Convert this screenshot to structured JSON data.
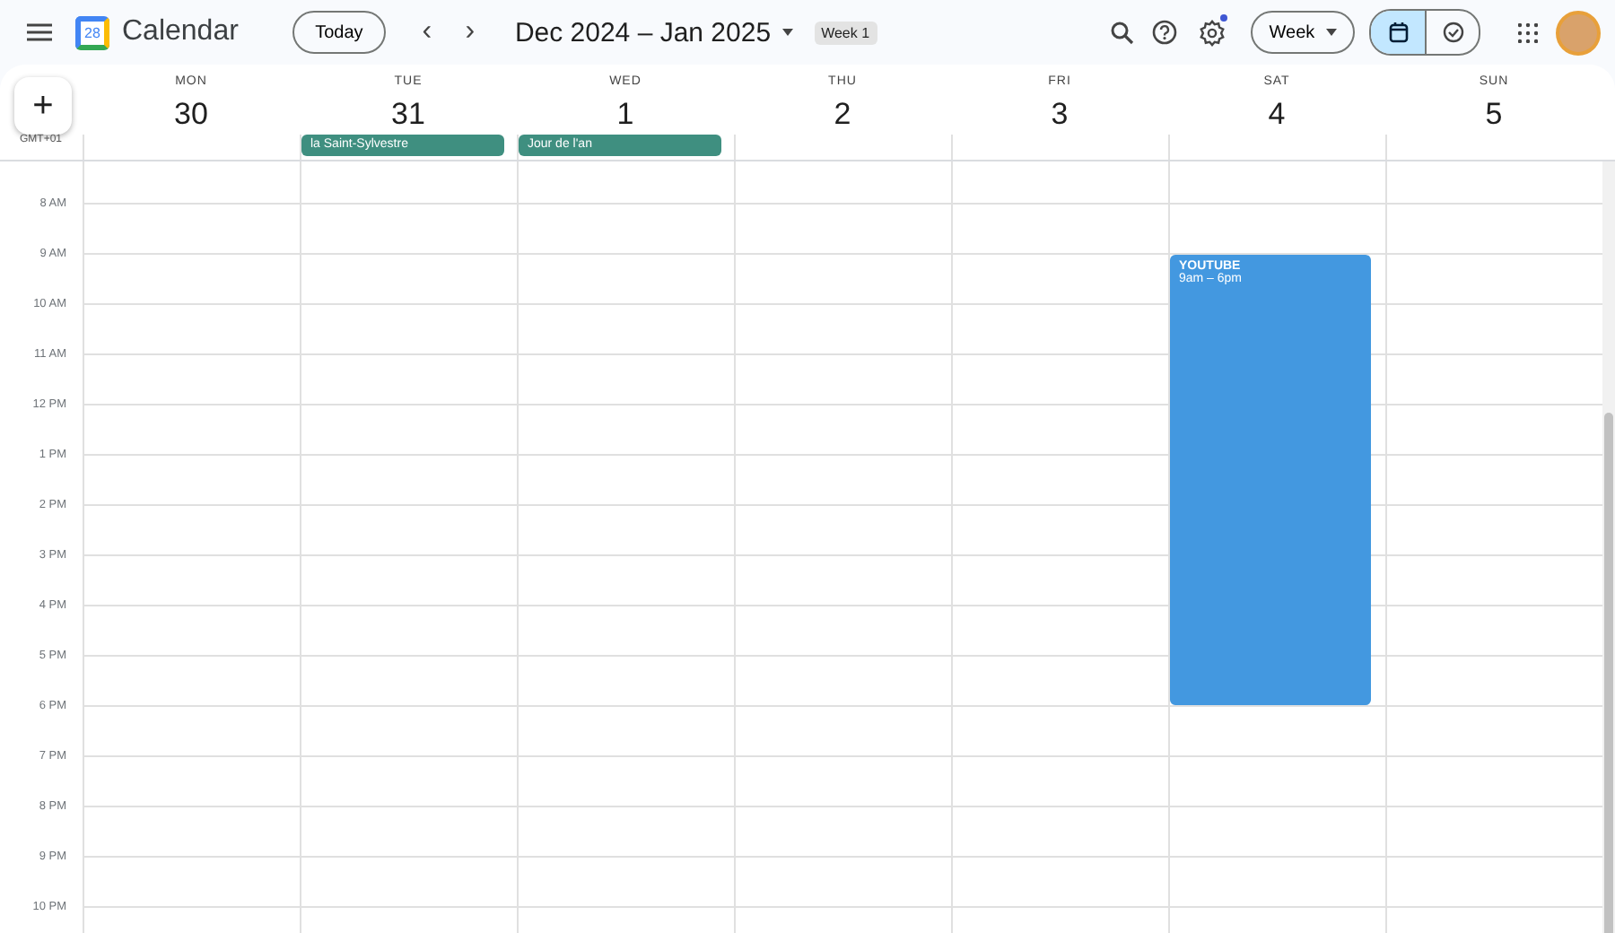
{
  "app": {
    "title": "Calendar",
    "logo_day": "28"
  },
  "toolbar": {
    "today": "Today",
    "prev": "‹",
    "next": "›",
    "range": "Dec 2024 – Jan 2025",
    "week_badge": "Week 1",
    "view": "Week",
    "settings_notification": true,
    "mode_toggle": [
      {
        "kind": "calendar",
        "selected": true
      },
      {
        "kind": "tasks",
        "selected": false
      }
    ]
  },
  "create": "+",
  "timezone": "GMT+01",
  "days": [
    {
      "weekday": "MON",
      "date": "30"
    },
    {
      "weekday": "TUE",
      "date": "31",
      "all_day": [
        {
          "title": "la Saint-Sylvestre",
          "color": "#3f8f80"
        }
      ]
    },
    {
      "weekday": "WED",
      "date": "1",
      "all_day": [
        {
          "title": "Jour de l'an",
          "color": "#3f8f80"
        }
      ]
    },
    {
      "weekday": "THU",
      "date": "2"
    },
    {
      "weekday": "FRI",
      "date": "3"
    },
    {
      "weekday": "SAT",
      "date": "4",
      "events": [
        {
          "title": "YOUTUBE",
          "time": "9am – 6pm",
          "color": "#4398e0"
        }
      ]
    },
    {
      "weekday": "SUN",
      "date": "5"
    }
  ],
  "hours": [
    "8 AM",
    "9 AM",
    "10 AM",
    "11 AM",
    "12 PM",
    "1 PM",
    "2 PM",
    "3 PM",
    "4 PM",
    "5 PM",
    "6 PM",
    "7 PM",
    "8 PM",
    "9 PM",
    "10 PM"
  ]
}
